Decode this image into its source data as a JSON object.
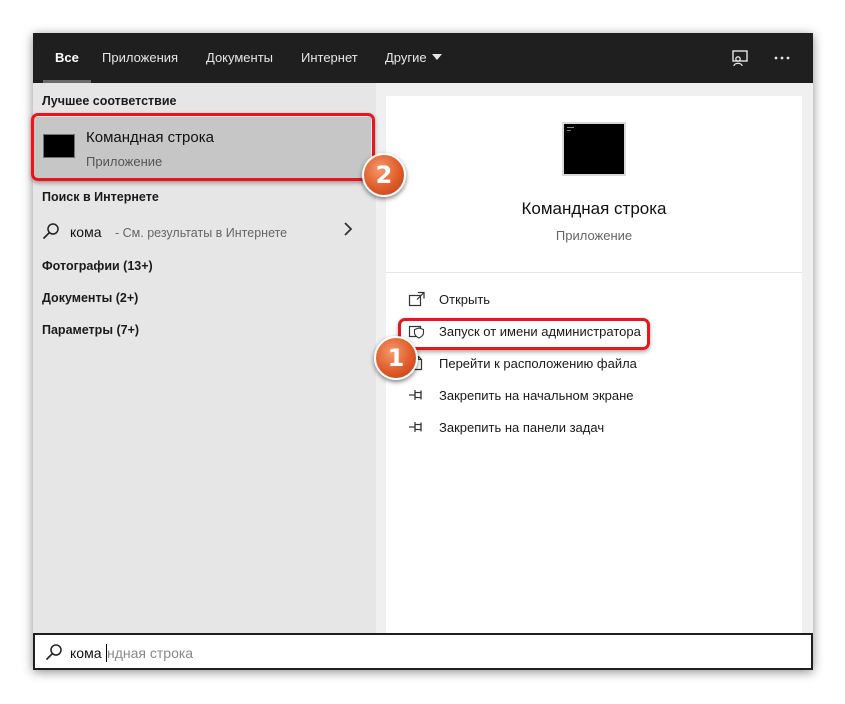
{
  "tabs": [
    {
      "label": "Все",
      "active": true
    },
    {
      "label": "Приложения"
    },
    {
      "label": "Документы"
    },
    {
      "label": "Интернет"
    },
    {
      "label": "Другие"
    }
  ],
  "icons": {
    "feedback": "feedback-icon",
    "more": "more-options-icon",
    "search": "search-icon",
    "chevron": "chevron-right-icon"
  },
  "left": {
    "best_match_header": "Лучшее соответствие",
    "best_match": {
      "title": "Командная строка",
      "subtitle": "Приложение"
    },
    "web_header": "Поиск в Интернете",
    "web_result": {
      "query": "кома",
      "hint": "- См. результаты в Интернете"
    },
    "categories": [
      "Фотографии (13+)",
      "Документы (2+)",
      "Параметры (7+)"
    ]
  },
  "detail": {
    "title": "Командная строка",
    "subtitle": "Приложение",
    "actions": [
      {
        "label": "Открыть",
        "icon": "open-icon"
      },
      {
        "label": "Запуск от имени администратора",
        "icon": "shield-icon"
      },
      {
        "label": "Перейти к расположению файла",
        "icon": "file-location-icon"
      },
      {
        "label": "Закрепить на начальном экране",
        "icon": "pin-icon"
      },
      {
        "label": "Закрепить на панели задач",
        "icon": "pin-icon"
      }
    ]
  },
  "search": {
    "typed": "кома",
    "suggestion": "ндная строка"
  },
  "annotations": {
    "badge_1": "1",
    "badge_2": "2"
  },
  "colors": {
    "highlight": "#e8151b",
    "badge": "#e05c2a",
    "topbar": "#1f1f1f"
  }
}
